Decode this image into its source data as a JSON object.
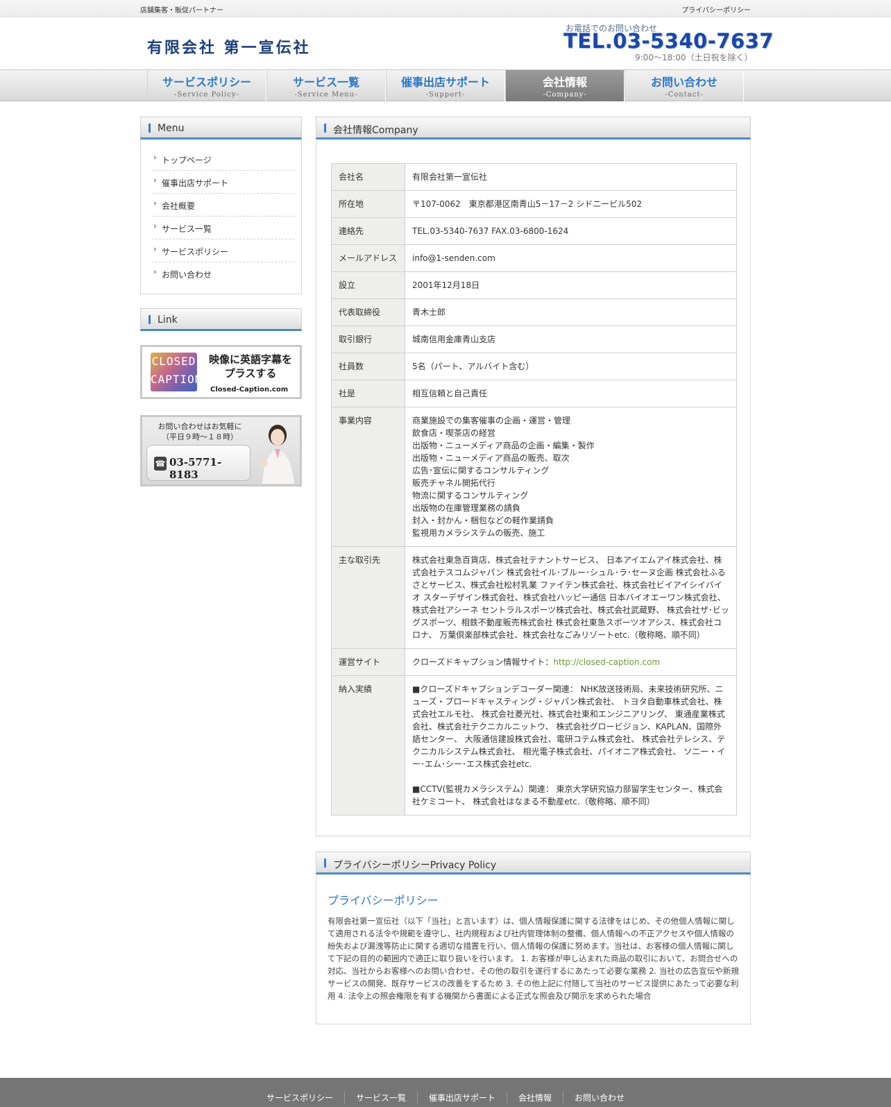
{
  "topbar": {
    "left": "店舗集客・販促パートナー",
    "right": "プライバシーポリシー"
  },
  "header": {
    "logo": "有限会社 第一宣伝社",
    "tel_caption": "お電話でのお問い合わせ",
    "tel": "TEL.03-5340-7637",
    "hours": "9:00〜18:00（土日祝を除く）"
  },
  "nav": [
    {
      "jp": "サービスポリシー",
      "en": "-Service Policy-"
    },
    {
      "jp": "サービス一覧",
      "en": "-Service Menu-"
    },
    {
      "jp": "催事出店サポート",
      "en": "-Support-"
    },
    {
      "jp": "会社情報",
      "en": "-Company-"
    },
    {
      "jp": "お問い合わせ",
      "en": "-Contact-"
    }
  ],
  "sidebar": {
    "menu_title": "Menu",
    "menu": [
      "トップページ",
      "催事出店サポート",
      "会社概要",
      "サービス一覧",
      "サービスポリシー",
      "お問い合わせ"
    ],
    "link_title": "Link",
    "cc_banner": {
      "mark1": "CLOSED",
      "mark2": "CAPTION",
      "text1": "映像に英語字幕を",
      "text2": "プラスする",
      "site": "Closed-Caption.com"
    },
    "contact_banner": {
      "line1": "お問い合わせはお気軽に",
      "line2": "（平日９時～１８時）",
      "phone": "03-5771-8183"
    }
  },
  "company": {
    "title": "会社情報Company",
    "rows": [
      {
        "k": "会社名",
        "v": "有限会社第一宣伝社"
      },
      {
        "k": "所在地",
        "v": "〒107-0062　東京都港区南青山5－17－2 シドニービル502"
      },
      {
        "k": "連絡先",
        "v": "TEL.03-5340-7637 FAX.03-6800-1624"
      },
      {
        "k": "メールアドレス",
        "v": "info@1-senden.com"
      },
      {
        "k": "設立",
        "v": "2001年12月18日"
      },
      {
        "k": "代表取締役",
        "v": "青木士郎"
      },
      {
        "k": "取引銀行",
        "v": "城南信用金庫青山支店"
      },
      {
        "k": "社員数",
        "v": "5名（パート、アルバイト含む）"
      },
      {
        "k": "社是",
        "v": "相互信頼と自己責任"
      },
      {
        "k": "事業内容",
        "v": "商業施設での集客催事の企画・運営・管理\n飲食店・喫茶店の経営\n出版物・ニューメディア商品の企画・編集・製作\n出版物・ニューメディア商品の販売、取次\n広告･宣伝に関するコンサルティング\n販売チャネル開拓代行\n物流に関するコンサルティング\n出版物の在庫管理業務の請負\n封入・封かん・梱包などの軽作業請負\n監視用カメラシステムの販売、施工"
      },
      {
        "k": "主な取引先",
        "v": "株式会社東急百貨店、株式会社テナントサービス、 日本アイエムアイ株式会社、株式会社テスコムジャパン 株式会社イル･ブルー･シュル･ラ･セーヌ企画 株式会社ふるさとサービス、株式会社松村乳業 ファイテン株式会社、株式会社ビイアイシイバイオ スターデザイン株式会社、株式会社ハッピー通信 日本バイオエーワン株式会社、株式会社アシーネ セントラルスポーツ株式会社、株式会社武蔵野、 株式会社ザ･ビッグスポーツ、相鉄不動産販売株式会社 株式会社東急スポーツオアシス、株式会社コロナ、 万葉倶楽部株式会社、株式会社なごみリゾートetc.（敬称略、順不同）"
      },
      {
        "k": "運営サイト",
        "v": "クローズドキャプション情報サイト：",
        "link": "http://closed-caption.com"
      },
      {
        "k": "納入実績",
        "v": "■クローズドキャプションデコーダー関連： NHK放送技術局、未来技術研究所、ニューズ・ブロードキャスティング・ジャパン株式会社、 トヨタ自動車株式会社、株式会社エルモ社、 株式会社菱光社、株式会社東和エンジニアリング、 東通産業株式会社、株式会社テクニカルニットウ、 株式会社グロービジョン、KAPLAN、国際外語センター、 大阪通信建設株式会社、電研コテム株式会社、 株式会社テレシス、テクニカルシステム株式会社、 相光電子株式会社、パイオニア株式会社、 ソニー・イー･エム･シー･エス株式会社etc.",
        "v2": "■CCTV(監視カメラシステム）関連： 東京大学研究協力部留学生センター、株式会社ケミコート、 株式会社はなまる不動産etc.（敬称略、順不同）"
      }
    ]
  },
  "privacy": {
    "title": "プライバシーポリシーPrivacy Policy",
    "heading": "プライバシーポリシー",
    "body": "有限会社第一宣伝社（以下「当社」と言います）は、個人情報保護に関する法律をはじめ、その他個人情報に関して適用される法令や規範を遵守し、社内規程および社内管理体制の整備、個人情報への不正アクセスや個人情報の紛失および漏洩等防止に関する適切な措置を行い、個人情報の保護に努めます。当社は、お客様の個人情報に関して下記の目的の範囲内で適正に取り扱いを行います。 1. お客様が申し込まれた商品の取引において、お問合せへの対応、当社からお客様へのお問い合わせ、その他の取引を遂行するにあたって必要な業務 2. 当社の広告宣伝や新規サービスの開発、既存サービスの改善をするため 3. その他上記に付随して当社のサービス提供にあたって必要な利用 4. 法令上の照会権限を有する機関から書面による正式な照会及び開示を求められた場合"
  },
  "footer": [
    "サービスポリシー",
    "サービス一覧",
    "催事出店サポート",
    "会社情報",
    "お問い合わせ"
  ],
  "colors": {
    "accent": "#2c78c4",
    "active_nav": "#888888",
    "footer_bg": "#757575"
  }
}
